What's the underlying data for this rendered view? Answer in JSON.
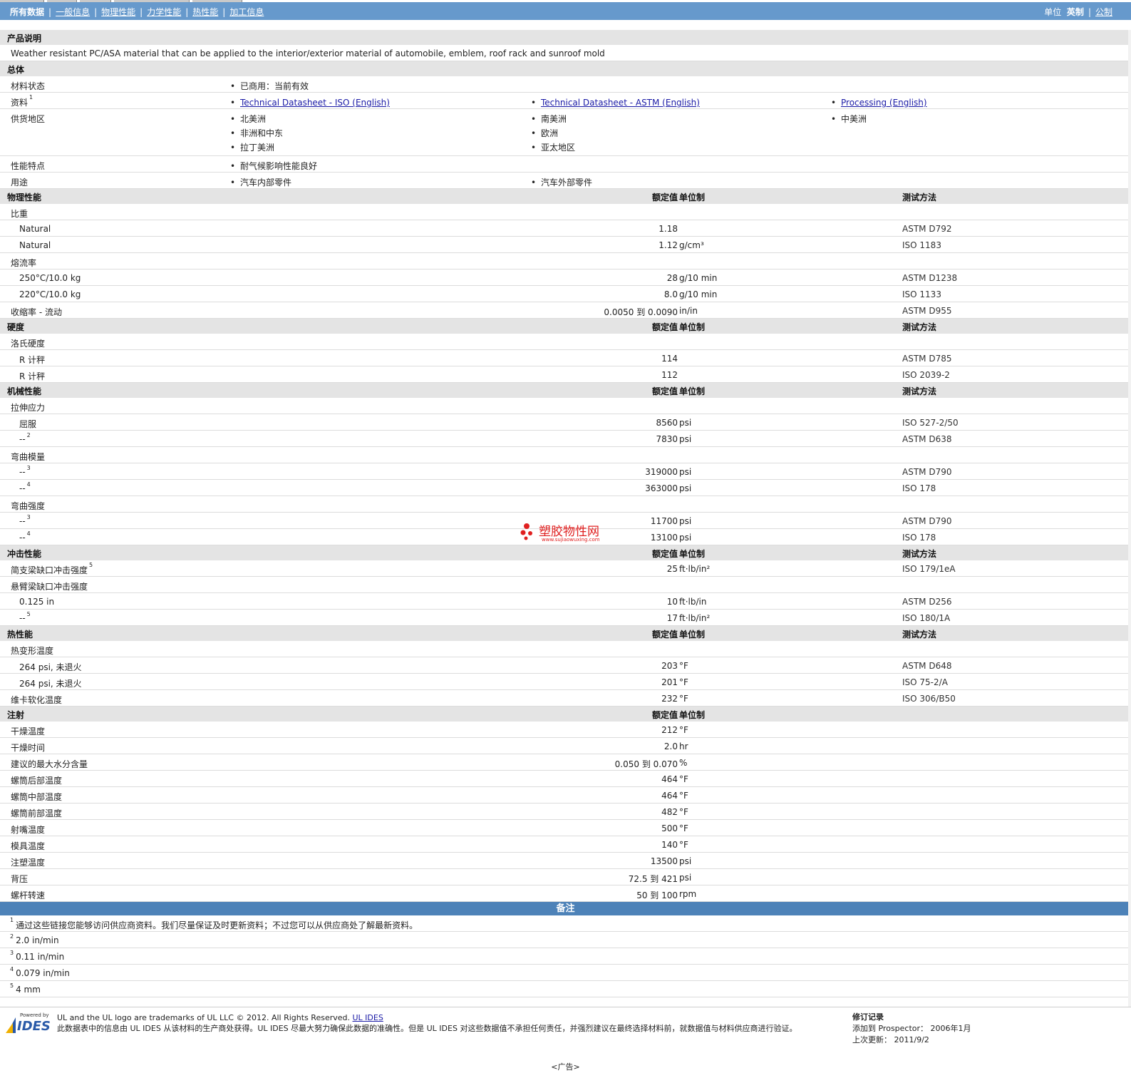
{
  "nav": {
    "items": [
      "所有数据",
      "一般信息",
      "物理性能",
      "力学性能",
      "热性能",
      "加工信息"
    ],
    "units_label": "单位",
    "unit_english": "英制",
    "unit_metric": "公制"
  },
  "col_headers": {
    "value": "额定值",
    "unit": "单位制",
    "test": "测试方法"
  },
  "product": {
    "title": "产品说明",
    "description": "Weather resistant PC/ASA material that can be applied to the interior/exterior material of automobile, emblem, roof rack and sunroof mold"
  },
  "general": {
    "title": "总体",
    "status_label": "材料状态",
    "status_value": "已商用：当前有效",
    "docs_label": "资料",
    "docs_sup": "1",
    "docs": [
      "Technical Datasheet - ISO (English)",
      "Technical Datasheet - ASTM (English)",
      "Processing (English)"
    ],
    "regions_label": "供货地区",
    "regions_col1": [
      "北美洲",
      "非洲和中东",
      "拉丁美洲"
    ],
    "regions_col2": [
      "南美洲",
      "欧洲",
      "亚太地区"
    ],
    "regions_col3": [
      "中美洲"
    ],
    "features_label": "性能特点",
    "features": [
      "耐气候影响性能良好"
    ],
    "uses_label": "用途",
    "uses": [
      "汽车内部零件",
      "汽车外部零件"
    ]
  },
  "physical": {
    "title": "物理性能",
    "rows": [
      {
        "label": "比重",
        "group": true
      },
      {
        "label": "Natural",
        "value": "1.18",
        "unit": "",
        "test": "ASTM D792"
      },
      {
        "label": "Natural",
        "value": "1.12",
        "unit": "g/cm³",
        "test": "ISO 1183"
      },
      {
        "label": "熔流率",
        "group": true
      },
      {
        "label": "250°C/10.0 kg",
        "value": "28",
        "unit": "g/10 min",
        "test": "ASTM D1238"
      },
      {
        "label": "220°C/10.0 kg",
        "value": "8.0",
        "unit": "g/10 min",
        "test": "ISO 1133"
      },
      {
        "label": "收缩率 - 流动",
        "top": true,
        "value": "0.0050 到  0.0090",
        "unit": "in/in",
        "test": "ASTM D955"
      }
    ]
  },
  "hardness": {
    "title": "硬度",
    "rows": [
      {
        "label": "洛氏硬度",
        "group": true
      },
      {
        "label": "R 计秤",
        "value": "114",
        "unit": "",
        "test": "ASTM D785"
      },
      {
        "label": "R 计秤",
        "value": "112",
        "unit": "",
        "test": "ISO 2039-2"
      }
    ]
  },
  "mechanical": {
    "title": "机械性能",
    "rows": [
      {
        "label": "拉伸应力",
        "group": true
      },
      {
        "label": "屈服",
        "value": "8560",
        "unit": "psi",
        "test": "ISO 527-2/50"
      },
      {
        "label": "--",
        "sup": "2",
        "value": "7830",
        "unit": "psi",
        "test": "ASTM D638"
      },
      {
        "label": "弯曲模量",
        "group": true
      },
      {
        "label": "--",
        "sup": "3",
        "value": "319000",
        "unit": "psi",
        "test": "ASTM D790"
      },
      {
        "label": "--",
        "sup": "4",
        "value": "363000",
        "unit": "psi",
        "test": "ISO 178"
      },
      {
        "label": "弯曲强度",
        "group": true
      },
      {
        "label": "--",
        "sup": "3",
        "value": "11700",
        "unit": "psi",
        "test": "ASTM D790"
      },
      {
        "label": "--",
        "sup": "4",
        "value": "13100",
        "unit": "psi",
        "test": "ISO 178"
      }
    ]
  },
  "impact": {
    "title": "冲击性能",
    "rows": [
      {
        "label": "简支梁缺口冲击强度",
        "top": true,
        "sup": "5",
        "value": "25",
        "unit": "ft·lb/in²",
        "test": "ISO 179/1eA"
      },
      {
        "label": "悬臂梁缺口冲击强度",
        "group": true
      },
      {
        "label": "0.125 in",
        "value": "10",
        "unit": "ft·lb/in",
        "test": "ASTM D256"
      },
      {
        "label": "--",
        "sup": "5",
        "value": "17",
        "unit": "ft·lb/in²",
        "test": "ISO 180/1A"
      }
    ]
  },
  "thermal": {
    "title": "热性能",
    "rows": [
      {
        "label": "热变形温度",
        "group": true
      },
      {
        "label": "264 psi, 未退火",
        "value": "203",
        "unit": "°F",
        "test": "ASTM D648"
      },
      {
        "label": "264 psi, 未退火",
        "value": "201",
        "unit": "°F",
        "test": "ISO 75-2/A"
      },
      {
        "label": "维卡软化温度",
        "top": true,
        "value": "232",
        "unit": "°F",
        "test": "ISO 306/B50"
      }
    ]
  },
  "injection": {
    "title": "注射",
    "rows": [
      {
        "label": "干燥温度",
        "top": true,
        "value": "212",
        "unit": "°F",
        "test": ""
      },
      {
        "label": "干燥时间",
        "top": true,
        "value": "2.0",
        "unit": "hr",
        "test": ""
      },
      {
        "label": "建议的最大水分含量",
        "top": true,
        "value": "0.050 到  0.070",
        "unit": "%",
        "test": ""
      },
      {
        "label": "螺筒后部温度",
        "top": true,
        "value": "464",
        "unit": "°F",
        "test": ""
      },
      {
        "label": "螺筒中部温度",
        "top": true,
        "value": "464",
        "unit": "°F",
        "test": ""
      },
      {
        "label": "螺筒前部温度",
        "top": true,
        "value": "482",
        "unit": "°F",
        "test": ""
      },
      {
        "label": "射嘴温度",
        "top": true,
        "value": "500",
        "unit": "°F",
        "test": ""
      },
      {
        "label": "模具温度",
        "top": true,
        "value": "140",
        "unit": "°F",
        "test": ""
      },
      {
        "label": "注塑温度",
        "top": true,
        "value": "13500",
        "unit": "psi",
        "test": ""
      },
      {
        "label": "背压",
        "top": true,
        "value": "72.5 到  421",
        "unit": "psi",
        "test": ""
      },
      {
        "label": "螺杆转速",
        "top": true,
        "value": "50 到  100",
        "unit": "rpm",
        "test": ""
      }
    ]
  },
  "notes": {
    "title": "备注",
    "items": [
      {
        "num": "1",
        "text": "通过这些链接您能够访问供应商资料。我们尽量保证及时更新资料；不过您可以从供应商处了解最新资料。"
      },
      {
        "num": "2",
        "text": "2.0 in/min"
      },
      {
        "num": "3",
        "text": "0.11 in/min"
      },
      {
        "num": "4",
        "text": "0.079 in/min"
      },
      {
        "num": "5",
        "text": "4 mm"
      }
    ]
  },
  "footer": {
    "logo_small": "Powered by",
    "logo_text": "IDES",
    "line1": "UL and the UL logo are trademarks of UL LLC © 2012. All Rights Reserved.",
    "line1_link": "UL IDES",
    "line2": "此数据表中的信息由  UL IDES 从该材料的生产商处获得。UL IDES 尽最大努力确保此数据的准确性。但是  UL IDES 对这些数据值不承担任何责任，并强烈建议在最终选择材料前，就数据值与材料供应商进行验证。",
    "rev_title": "修订记录",
    "rev_added": "添加到  Prospector：  2006年1月",
    "rev_updated": "上次更新：  2011/9/2",
    "ad": "<广告>"
  },
  "watermark": {
    "text": "塑胶物性网",
    "url": "www.sujiaowuxing.com"
  }
}
